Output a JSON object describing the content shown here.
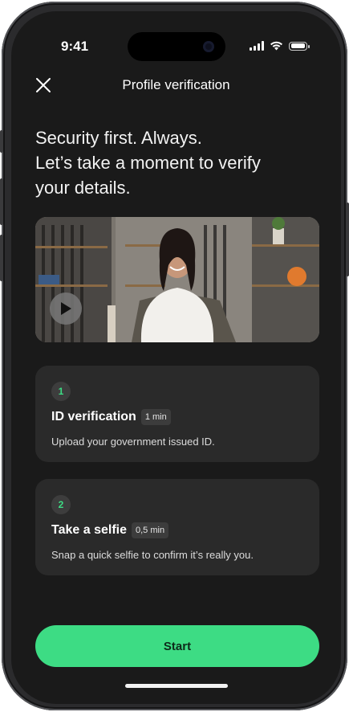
{
  "status_bar": {
    "time": "9:41"
  },
  "header": {
    "title": "Profile verification"
  },
  "headline": {
    "line1": "Security first. Always.",
    "line2": "Let’s take a moment to verify",
    "line3": "your details."
  },
  "steps": [
    {
      "number": "1",
      "title": "ID verification",
      "duration": "1 min",
      "description": "Upload your government issued ID."
    },
    {
      "number": "2",
      "title": "Take a selfie",
      "duration": "0,5 min",
      "description": "Snap a quick selfie to confirm it’s really you."
    }
  ],
  "start_button": {
    "label": "Start"
  },
  "colors": {
    "accent": "#3ddc84",
    "background": "#1a1a1a",
    "card": "#2a2a2a"
  }
}
